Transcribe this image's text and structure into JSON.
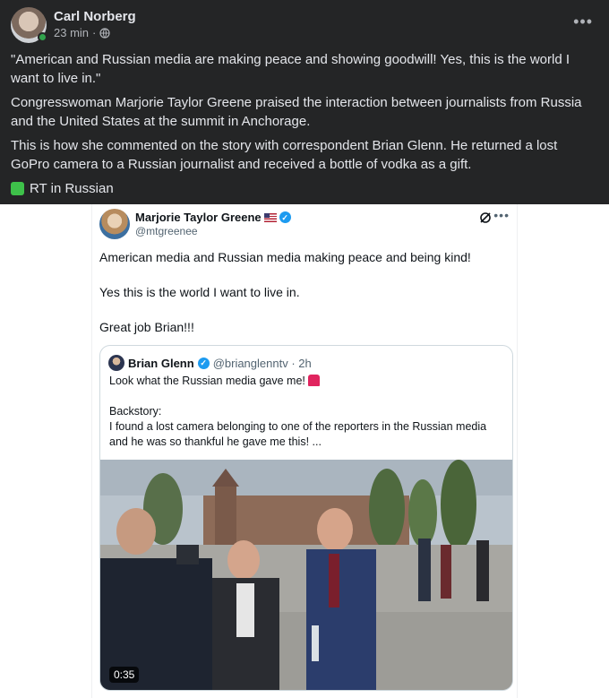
{
  "post": {
    "author": "Carl Norberg",
    "time": "23 min",
    "more_icon": "more-horizontal-icon",
    "paragraphs": [
      "\"American and Russian media are making peace and showing goodwill! Yes, this is the world I want to live in.\"",
      "Congresswoman Marjorie Taylor Greene praised the interaction between journalists from Russia and the United States at the summit in Anchorage.",
      "This is how she commented on the story with correspondent Brian Glenn. He returned a lost GoPro camera to a Russian journalist and received a bottle of vodka as a gift."
    ],
    "source": "RT in Russian"
  },
  "tweet": {
    "name": "Marjorie Taylor Greene",
    "handle": "@mtgreenee",
    "lines": [
      "American media and Russian media making peace and being kind!",
      "Yes this is the world I want to live in.",
      "Great job Brian!!!"
    ],
    "quote": {
      "name": "Brian Glenn",
      "handle": "@brianglenntv · 2h",
      "text1": "Look what the Russian media gave me!",
      "text2_title": "Backstory:",
      "text2_body": "I found a lost camera belonging to one of the reporters in the Russian media and he was so thankful he gave me this! ...",
      "video_duration": "0:35"
    }
  },
  "colors": {
    "fb_bg": "#242526",
    "fb_text": "#e4e6eb",
    "verified": "#1d9bf0",
    "online": "#31a24c"
  }
}
